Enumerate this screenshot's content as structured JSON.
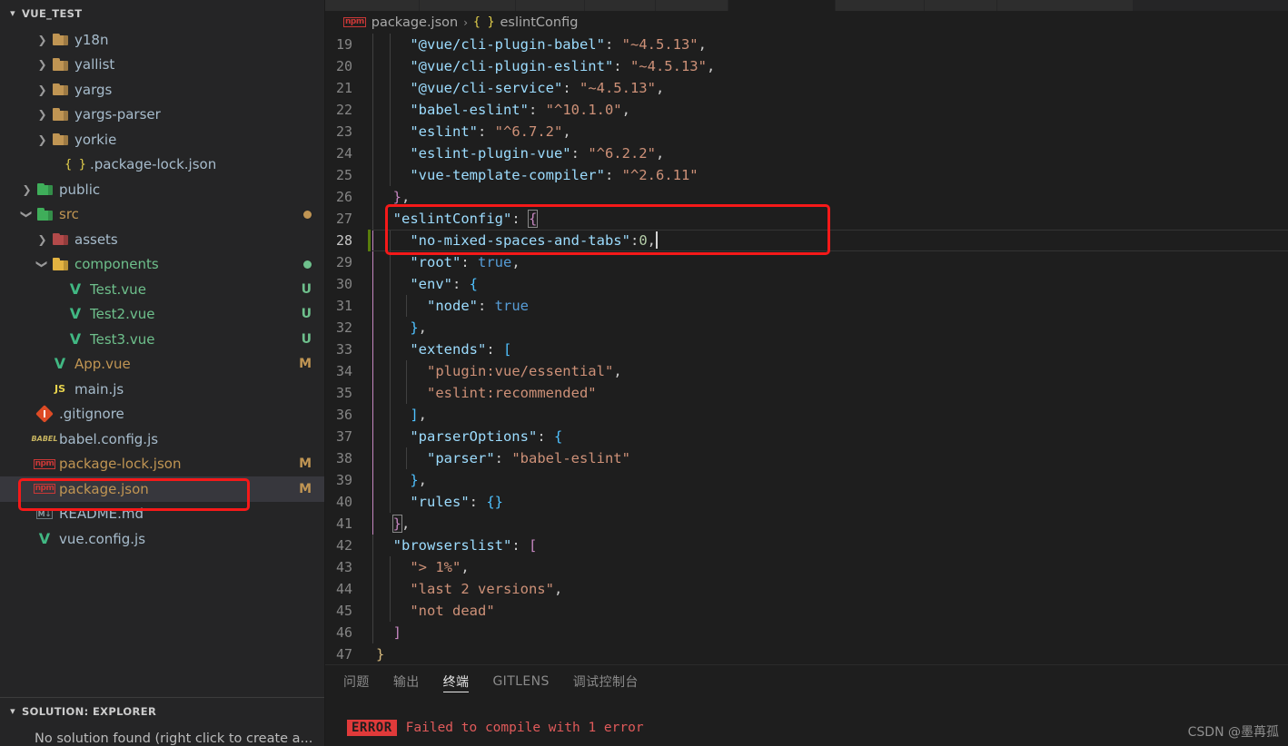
{
  "sidebar": {
    "explorer_title": "VUE_TEST",
    "solution_title": "SOLUTION: EXPLORER",
    "solution_empty_text": "No solution found (right click to create a...",
    "tree": [
      {
        "label": "y18n",
        "icon": "folder-icon",
        "twisty": "chevron-right",
        "indent": 2,
        "badge": "",
        "dot": "",
        "color": "grey"
      },
      {
        "label": "yallist",
        "icon": "folder-icon",
        "twisty": "chevron-right",
        "indent": 2,
        "badge": "",
        "dot": "",
        "color": "grey"
      },
      {
        "label": "yargs",
        "icon": "folder-icon",
        "twisty": "chevron-right",
        "indent": 2,
        "badge": "",
        "dot": "",
        "color": "grey"
      },
      {
        "label": "yargs-parser",
        "icon": "folder-icon",
        "twisty": "chevron-right",
        "indent": 2,
        "badge": "",
        "dot": "",
        "color": "grey"
      },
      {
        "label": "yorkie",
        "icon": "folder-icon",
        "twisty": "chevron-right",
        "indent": 2,
        "badge": "",
        "dot": "",
        "color": "grey"
      },
      {
        "label": ".package-lock.json",
        "icon": "json-icon",
        "twisty": "",
        "indent": 3,
        "badge": "",
        "dot": "",
        "color": "grey"
      },
      {
        "label": "public",
        "icon": "folder-public-icon",
        "twisty": "chevron-right",
        "indent": 1,
        "badge": "",
        "dot": "",
        "color": "grey"
      },
      {
        "label": "src",
        "icon": "folder-src-icon",
        "twisty": "chevron-down",
        "indent": 1,
        "badge": "",
        "dot": "modified",
        "color": "modified"
      },
      {
        "label": "assets",
        "icon": "folder-assets-icon",
        "twisty": "chevron-right",
        "indent": 2,
        "badge": "",
        "dot": "",
        "color": "grey"
      },
      {
        "label": "components",
        "icon": "folder-components-icon",
        "twisty": "chevron-down",
        "indent": 2,
        "badge": "",
        "dot": "untracked",
        "color": "untracked"
      },
      {
        "label": "Test.vue",
        "icon": "vue-icon",
        "twisty": "",
        "indent": 3,
        "badge": "U",
        "dot": "",
        "color": "untracked"
      },
      {
        "label": "Test2.vue",
        "icon": "vue-icon",
        "twisty": "",
        "indent": 3,
        "badge": "U",
        "dot": "",
        "color": "untracked"
      },
      {
        "label": "Test3.vue",
        "icon": "vue-icon",
        "twisty": "",
        "indent": 3,
        "badge": "U",
        "dot": "",
        "color": "untracked"
      },
      {
        "label": "App.vue",
        "icon": "vue-icon",
        "twisty": "",
        "indent": 2,
        "badge": "M",
        "dot": "",
        "color": "modified"
      },
      {
        "label": "main.js",
        "icon": "js-icon",
        "twisty": "",
        "indent": 2,
        "badge": "",
        "dot": "",
        "color": "grey"
      },
      {
        "label": ".gitignore",
        "icon": "git-icon",
        "twisty": "",
        "indent": 1,
        "badge": "",
        "dot": "",
        "color": "grey"
      },
      {
        "label": "babel.config.js",
        "icon": "babel-icon",
        "twisty": "",
        "indent": 1,
        "badge": "",
        "dot": "",
        "color": "grey"
      },
      {
        "label": "package-lock.json",
        "icon": "npm-icon",
        "twisty": "",
        "indent": 1,
        "badge": "M",
        "dot": "",
        "color": "modified"
      },
      {
        "label": "package.json",
        "icon": "npm-icon",
        "twisty": "",
        "indent": 1,
        "badge": "M",
        "dot": "",
        "color": "modified",
        "selected": true,
        "annotated": true
      },
      {
        "label": "README.md",
        "icon": "markdown-icon",
        "twisty": "",
        "indent": 1,
        "badge": "",
        "dot": "",
        "color": "grey"
      },
      {
        "label": "vue.config.js",
        "icon": "vue-config-icon",
        "twisty": "",
        "indent": 1,
        "badge": "",
        "dot": "",
        "color": "grey"
      }
    ]
  },
  "editor": {
    "breadcrumb": {
      "file_icon": "npm-icon",
      "file": "package.json",
      "separator": "›",
      "symbol_icon": "{ }",
      "symbol": "eslintConfig"
    },
    "first_line_number": 19,
    "cursor_line": 28,
    "lines": [
      {
        "n": 19,
        "indent": 2,
        "tokens": [
          {
            "t": "str-key",
            "v": "\"@vue/cli-plugin-babel\""
          },
          {
            "t": "punc",
            "v": ": "
          },
          {
            "t": "str",
            "v": "\"~4.5.13\""
          },
          {
            "t": "punc",
            "v": ","
          }
        ]
      },
      {
        "n": 20,
        "indent": 2,
        "tokens": [
          {
            "t": "str-key",
            "v": "\"@vue/cli-plugin-eslint\""
          },
          {
            "t": "punc",
            "v": ": "
          },
          {
            "t": "str",
            "v": "\"~4.5.13\""
          },
          {
            "t": "punc",
            "v": ","
          }
        ]
      },
      {
        "n": 21,
        "indent": 2,
        "tokens": [
          {
            "t": "str-key",
            "v": "\"@vue/cli-service\""
          },
          {
            "t": "punc",
            "v": ": "
          },
          {
            "t": "str",
            "v": "\"~4.5.13\""
          },
          {
            "t": "punc",
            "v": ","
          }
        ]
      },
      {
        "n": 22,
        "indent": 2,
        "tokens": [
          {
            "t": "str-key",
            "v": "\"babel-eslint\""
          },
          {
            "t": "punc",
            "v": ": "
          },
          {
            "t": "str",
            "v": "\"^10.1.0\""
          },
          {
            "t": "punc",
            "v": ","
          }
        ]
      },
      {
        "n": 23,
        "indent": 2,
        "tokens": [
          {
            "t": "str-key",
            "v": "\"eslint\""
          },
          {
            "t": "punc",
            "v": ": "
          },
          {
            "t": "str",
            "v": "\"^6.7.2\""
          },
          {
            "t": "punc",
            "v": ","
          }
        ]
      },
      {
        "n": 24,
        "indent": 2,
        "tokens": [
          {
            "t": "str-key",
            "v": "\"eslint-plugin-vue\""
          },
          {
            "t": "punc",
            "v": ": "
          },
          {
            "t": "str",
            "v": "\"^6.2.2\""
          },
          {
            "t": "punc",
            "v": ","
          }
        ]
      },
      {
        "n": 25,
        "indent": 2,
        "tokens": [
          {
            "t": "str-key",
            "v": "\"vue-template-compiler\""
          },
          {
            "t": "punc",
            "v": ": "
          },
          {
            "t": "str",
            "v": "\"^2.6.11\""
          }
        ]
      },
      {
        "n": 26,
        "indent": 1,
        "tokens": [
          {
            "t": "brace2",
            "v": "}"
          },
          {
            "t": "punc",
            "v": ","
          }
        ]
      },
      {
        "n": 27,
        "indent": 1,
        "tokens": [
          {
            "t": "str-key",
            "v": "\"eslintConfig\""
          },
          {
            "t": "punc",
            "v": ": "
          },
          {
            "t": "brace-match",
            "v": "{"
          }
        ]
      },
      {
        "n": 28,
        "indent": 2,
        "tokens": [
          {
            "t": "str-key",
            "v": "\"no-mixed-spaces-and-tabs\""
          },
          {
            "t": "punc",
            "v": ":"
          },
          {
            "t": "num",
            "v": "0"
          },
          {
            "t": "punc",
            "v": ","
          },
          {
            "t": "caret",
            "v": ""
          }
        ]
      },
      {
        "n": 29,
        "indent": 2,
        "tokens": [
          {
            "t": "str-key",
            "v": "\"root\""
          },
          {
            "t": "punc",
            "v": ": "
          },
          {
            "t": "bool",
            "v": "true"
          },
          {
            "t": "punc",
            "v": ","
          }
        ]
      },
      {
        "n": 30,
        "indent": 2,
        "tokens": [
          {
            "t": "str-key",
            "v": "\"env\""
          },
          {
            "t": "punc",
            "v": ": "
          },
          {
            "t": "brace3",
            "v": "{"
          }
        ]
      },
      {
        "n": 31,
        "indent": 3,
        "tokens": [
          {
            "t": "str-key",
            "v": "\"node\""
          },
          {
            "t": "punc",
            "v": ": "
          },
          {
            "t": "bool",
            "v": "true"
          }
        ]
      },
      {
        "n": 32,
        "indent": 2,
        "tokens": [
          {
            "t": "brace3",
            "v": "}"
          },
          {
            "t": "punc",
            "v": ","
          }
        ]
      },
      {
        "n": 33,
        "indent": 2,
        "tokens": [
          {
            "t": "str-key",
            "v": "\"extends\""
          },
          {
            "t": "punc",
            "v": ": "
          },
          {
            "t": "brace3",
            "v": "["
          }
        ]
      },
      {
        "n": 34,
        "indent": 3,
        "tokens": [
          {
            "t": "str",
            "v": "\"plugin:vue/essential\""
          },
          {
            "t": "punc",
            "v": ","
          }
        ]
      },
      {
        "n": 35,
        "indent": 3,
        "tokens": [
          {
            "t": "str",
            "v": "\"eslint:recommended\""
          }
        ]
      },
      {
        "n": 36,
        "indent": 2,
        "tokens": [
          {
            "t": "brace3",
            "v": "]"
          },
          {
            "t": "punc",
            "v": ","
          }
        ]
      },
      {
        "n": 37,
        "indent": 2,
        "tokens": [
          {
            "t": "str-key",
            "v": "\"parserOptions\""
          },
          {
            "t": "punc",
            "v": ": "
          },
          {
            "t": "brace3",
            "v": "{"
          }
        ]
      },
      {
        "n": 38,
        "indent": 3,
        "tokens": [
          {
            "t": "str-key",
            "v": "\"parser\""
          },
          {
            "t": "punc",
            "v": ": "
          },
          {
            "t": "str",
            "v": "\"babel-eslint\""
          }
        ]
      },
      {
        "n": 39,
        "indent": 2,
        "tokens": [
          {
            "t": "brace3",
            "v": "}"
          },
          {
            "t": "punc",
            "v": ","
          }
        ]
      },
      {
        "n": 40,
        "indent": 2,
        "tokens": [
          {
            "t": "str-key",
            "v": "\"rules\""
          },
          {
            "t": "punc",
            "v": ": "
          },
          {
            "t": "brace3",
            "v": "{}"
          }
        ]
      },
      {
        "n": 41,
        "indent": 1,
        "tokens": [
          {
            "t": "brace-match",
            "v": "}"
          },
          {
            "t": "punc",
            "v": ","
          }
        ]
      },
      {
        "n": 42,
        "indent": 1,
        "tokens": [
          {
            "t": "str-key",
            "v": "\"browserslist\""
          },
          {
            "t": "punc",
            "v": ": "
          },
          {
            "t": "brace2",
            "v": "["
          }
        ]
      },
      {
        "n": 43,
        "indent": 2,
        "tokens": [
          {
            "t": "str",
            "v": "\"> 1%\""
          },
          {
            "t": "punc",
            "v": ","
          }
        ]
      },
      {
        "n": 44,
        "indent": 2,
        "tokens": [
          {
            "t": "str",
            "v": "\"last 2 versions\""
          },
          {
            "t": "punc",
            "v": ","
          }
        ]
      },
      {
        "n": 45,
        "indent": 2,
        "tokens": [
          {
            "t": "str",
            "v": "\"not dead\""
          }
        ]
      },
      {
        "n": 46,
        "indent": 1,
        "tokens": [
          {
            "t": "brace2",
            "v": "]"
          }
        ]
      },
      {
        "n": 47,
        "indent": 0,
        "tokens": [
          {
            "t": "brace1",
            "v": "}"
          }
        ]
      }
    ]
  },
  "panel": {
    "tabs": [
      {
        "label": "问题",
        "active": false
      },
      {
        "label": "输出",
        "active": false
      },
      {
        "label": "终端",
        "active": true
      },
      {
        "label": "GITLENS",
        "active": false
      },
      {
        "label": "调试控制台",
        "active": false
      }
    ],
    "terminal": {
      "badge": "ERROR",
      "message": "Failed to compile with 1 error"
    }
  },
  "watermark": "CSDN @墨苒孤",
  "colors": {
    "annotation": "#f51919",
    "accent_modified": "#c09553",
    "accent_untracked": "#6ec08c",
    "error": "#e03a3a"
  }
}
